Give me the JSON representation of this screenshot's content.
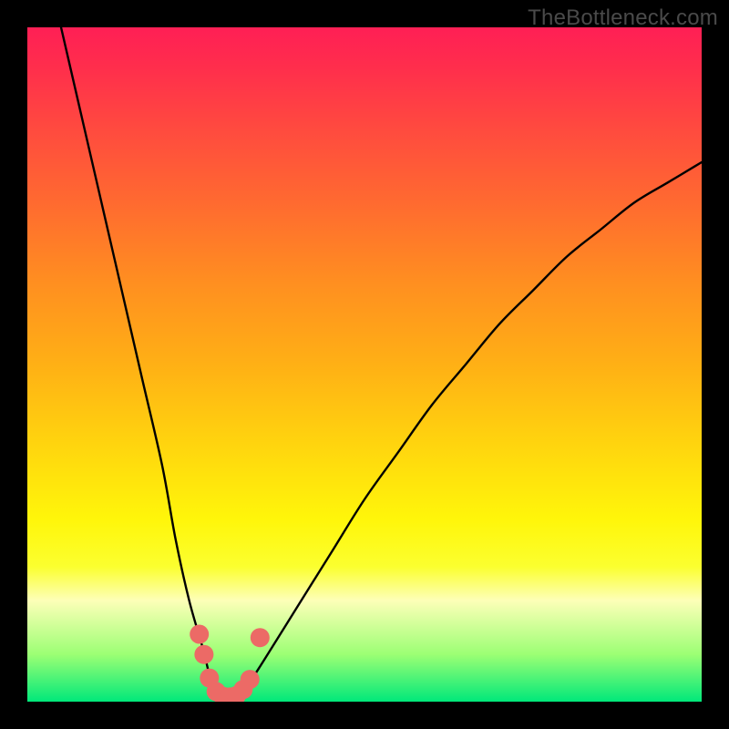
{
  "watermark": "TheBottleneck.com",
  "chart_data": {
    "type": "line",
    "title": "",
    "xlabel": "",
    "ylabel": "",
    "xlim": [
      0,
      100
    ],
    "ylim": [
      0,
      100
    ],
    "series": [
      {
        "name": "bottleneck-curve",
        "x": [
          5,
          8,
          11,
          14,
          17,
          20,
          22,
          24,
          26,
          27,
          28,
          29,
          30,
          31,
          33,
          35,
          40,
          45,
          50,
          55,
          60,
          65,
          70,
          75,
          80,
          85,
          90,
          95,
          100
        ],
        "values": [
          100,
          87,
          74,
          61,
          48,
          35,
          24,
          15,
          8,
          4,
          1,
          0,
          0,
          1,
          3,
          6,
          14,
          22,
          30,
          37,
          44,
          50,
          56,
          61,
          66,
          70,
          74,
          77,
          80
        ]
      }
    ],
    "markers": {
      "name": "highlight-points",
      "x": [
        25.5,
        26.2,
        27,
        28,
        29,
        30,
        31,
        32,
        33,
        34.5
      ],
      "values": [
        10,
        7,
        3.5,
        1.5,
        0.8,
        0.7,
        0.9,
        1.8,
        3.3,
        9.5
      ]
    },
    "background_gradient": {
      "top_color": "#ff1f55",
      "mid_color": "#fff60a",
      "bottom_color": "#00e87a"
    }
  }
}
